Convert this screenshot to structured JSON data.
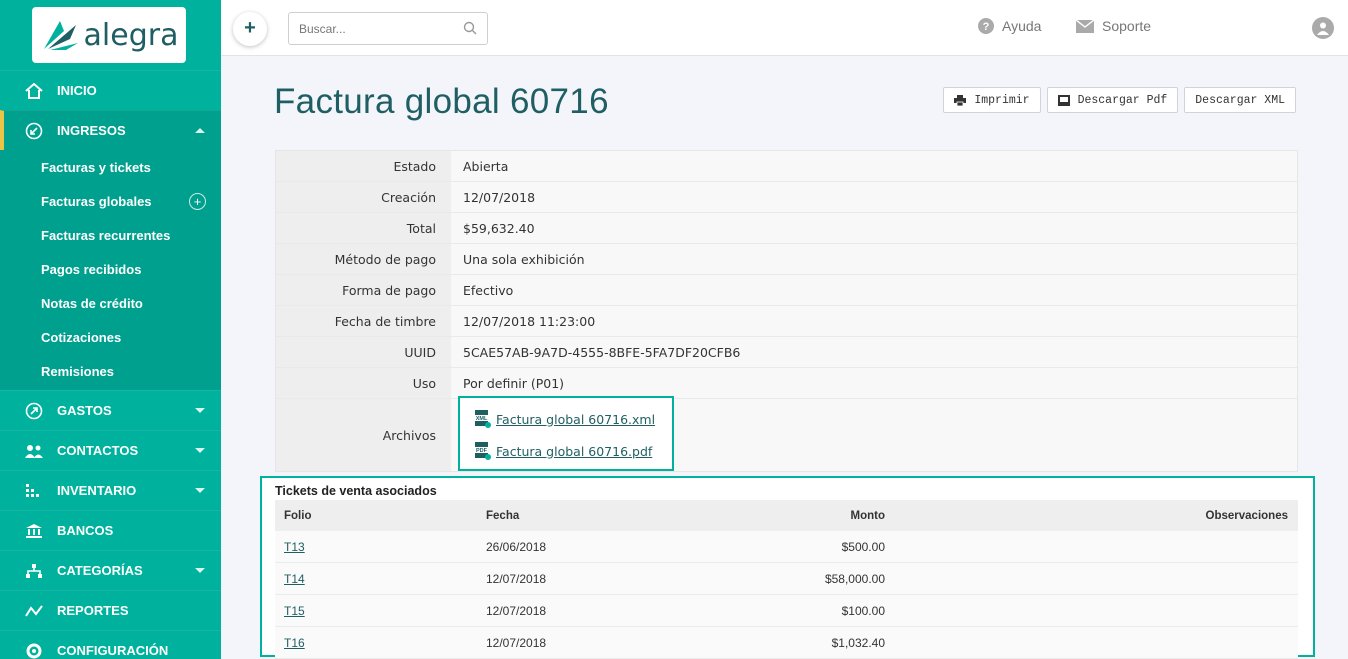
{
  "brand": {
    "name": "alegra",
    "color": "#00b19d",
    "accent": "#1f5f63",
    "active_marker": "#e8c547"
  },
  "sidebar": {
    "items": [
      {
        "label": "INICIO",
        "icon": "home-icon"
      },
      {
        "label": "INGRESOS",
        "icon": "income-icon",
        "expanded": true,
        "subitems": [
          {
            "label": "Facturas y tickets"
          },
          {
            "label": "Facturas globales",
            "add": "+"
          },
          {
            "label": "Facturas recurrentes"
          },
          {
            "label": "Pagos recibidos"
          },
          {
            "label": "Notas de crédito"
          },
          {
            "label": "Cotizaciones"
          },
          {
            "label": "Remisiones"
          }
        ]
      },
      {
        "label": "GASTOS",
        "icon": "expense-icon"
      },
      {
        "label": "CONTACTOS",
        "icon": "contacts-icon"
      },
      {
        "label": "INVENTARIO",
        "icon": "inventory-icon"
      },
      {
        "label": "BANCOS",
        "icon": "bank-icon"
      },
      {
        "label": "CATEGORÍAS",
        "icon": "categories-icon"
      },
      {
        "label": "REPORTES",
        "icon": "reports-icon"
      },
      {
        "label": "CONFIGURACIÓN",
        "icon": "gear-icon"
      }
    ]
  },
  "topbar": {
    "add_label": "+",
    "search_placeholder": "Buscar...",
    "help_label": "Ayuda",
    "support_label": "Soporte"
  },
  "page": {
    "title": "Factura global 60716",
    "actions": {
      "print": "Imprimir",
      "pdf": "Descargar Pdf",
      "xml": "Descargar XML"
    }
  },
  "details": [
    {
      "label": "Estado",
      "value": "Abierta"
    },
    {
      "label": "Creación",
      "value": "12/07/2018"
    },
    {
      "label": "Total",
      "value": "$59,632.40"
    },
    {
      "label": "Método de pago",
      "value": "Una sola exhibición"
    },
    {
      "label": "Forma de pago",
      "value": "Efectivo"
    },
    {
      "label": "Fecha de timbre",
      "value": "12/07/2018 11:23:00"
    },
    {
      "label": "UUID",
      "value": "5CAE57AB-9A7D-4555-8BFE-5FA7DF20CFB6"
    },
    {
      "label": "Uso",
      "value": "Por definir (P01)"
    }
  ],
  "files": {
    "label": "Archivos",
    "items": [
      {
        "name": "Factura global 60716.xml",
        "icon": "xml-file-icon"
      },
      {
        "name": "Factura global 60716.pdf",
        "icon": "pdf-file-icon"
      }
    ]
  },
  "tickets": {
    "title": "Tickets de venta asociados",
    "columns": [
      "Folio",
      "Fecha",
      "Monto",
      "Observaciones"
    ],
    "rows": [
      {
        "folio": "T13",
        "fecha": "26/06/2018",
        "monto": "$500.00",
        "obs": ""
      },
      {
        "folio": "T14",
        "fecha": "12/07/2018",
        "monto": "$58,000.00",
        "obs": ""
      },
      {
        "folio": "T15",
        "fecha": "12/07/2018",
        "monto": "$100.00",
        "obs": ""
      },
      {
        "folio": "T16",
        "fecha": "12/07/2018",
        "monto": "$1,032.40",
        "obs": ""
      }
    ]
  }
}
